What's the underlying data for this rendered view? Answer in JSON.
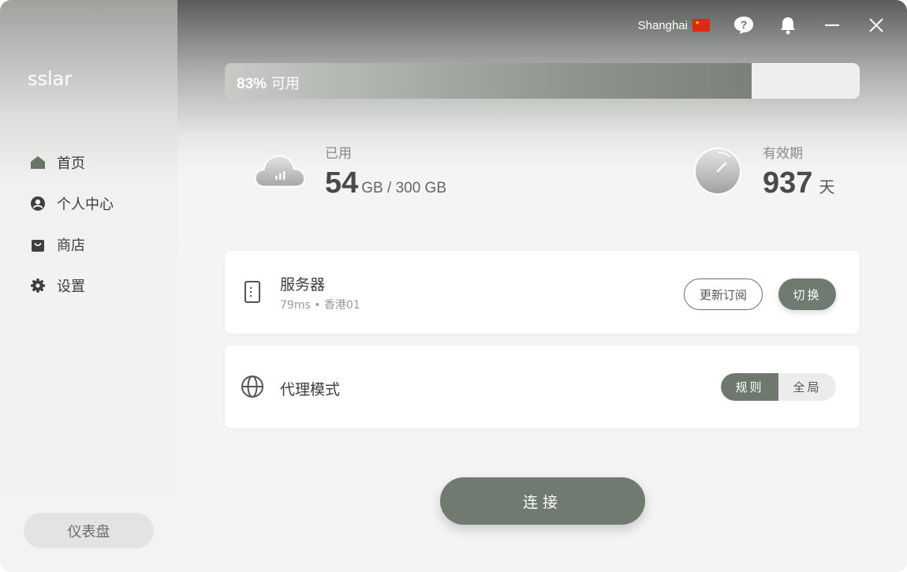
{
  "app": {
    "brand": "sslar"
  },
  "sidebar": {
    "items": [
      {
        "label": "首页",
        "icon": "home-icon"
      },
      {
        "label": "个人中心",
        "icon": "user-icon"
      },
      {
        "label": "商店",
        "icon": "shopping-bag-icon"
      },
      {
        "label": "设置",
        "icon": "gear-icon"
      }
    ],
    "dashboard_label": "仪表盘"
  },
  "topbar": {
    "location": "Shanghai",
    "flag": "cn-flag-icon"
  },
  "usage": {
    "percent_text": "83%",
    "label": "可用",
    "fraction": 0.83
  },
  "stats": {
    "used": {
      "label": "已用",
      "value": "54",
      "detail": "GB / 300 GB"
    },
    "validity": {
      "label": "有效期",
      "value": "937",
      "unit": "天"
    }
  },
  "server": {
    "title": "服务器",
    "subtitle": "79ms • 香港01",
    "update_label": "更新订阅",
    "switch_label": "切换"
  },
  "proxy": {
    "title": "代理模式",
    "mode_rule": "规则",
    "mode_global": "全局"
  },
  "connect_label": "连接",
  "colors": {
    "accent": "#707a70",
    "sidebar_text": "#3d3d3d"
  }
}
